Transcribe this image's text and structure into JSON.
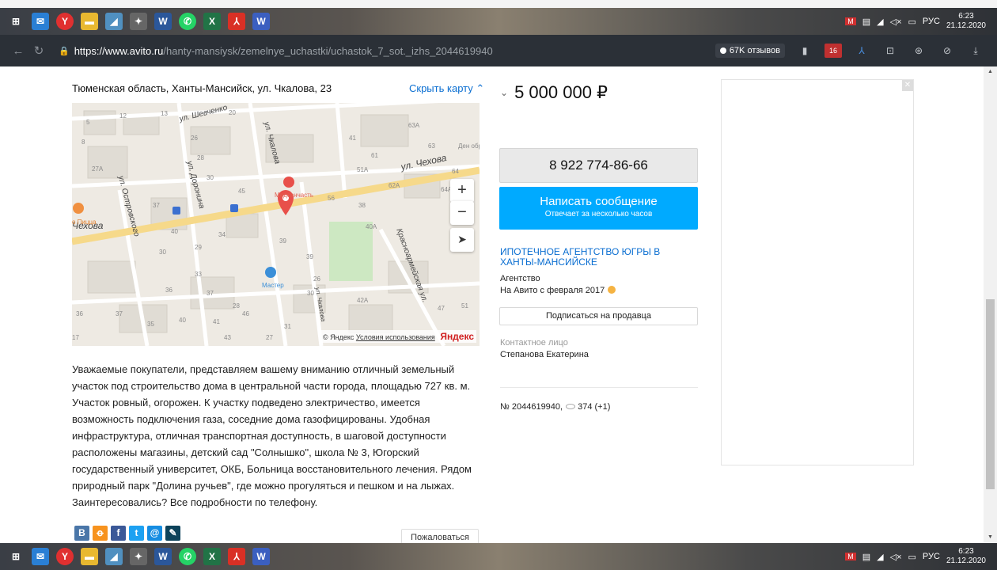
{
  "taskbar": {
    "lang": "РУС",
    "time": "6:23",
    "date": "21.12.2020",
    "icons": [
      "windows-icon",
      "mail-icon",
      "yandex-browser-icon",
      "file-explorer-icon",
      "app-icon",
      "app-icon-2",
      "word-icon",
      "whatsapp-icon",
      "excel-icon",
      "pdf-icon",
      "word-doc-icon"
    ]
  },
  "browser": {
    "url_host": "https://www.avito.ru",
    "url_path": "/hanty-mansiysk/zemelnye_uchastki/uchastok_7_sot._izhs_2044619940",
    "reviews": "67K отзывов",
    "ext_badge": "16"
  },
  "listing": {
    "address": "Тюменская область, Ханты-Мансийск, ул. Чкалова, 23",
    "hide_map": "Скрыть карту",
    "price": "5 000 000 ₽",
    "description": "Уважаемые покупатели, представляем вашему вниманию отличный земельный участок под строительство дома в центральной части города, площадью 727 кв. м. Участок ровный, огорожен. К участку подведено электричество, имеется возможность подключения газа, соседние дома газофицированы. Удобная инфраструктура, отличная транспортная доступность, в шаговой доступности расположены магазины, детский сад \"Солнышко\", школа № 3, Югорский государственный университет, ОКБ, Больница восстановительного лечения. Рядом природный парк \"Долина ручьев\", где можно прогуляться и пешком и на лыжах. Заинтересовались? Все подробности по телефону.",
    "complain": "Пожаловаться",
    "ad_id": "№ 2044619940,",
    "views": "374 (+1)"
  },
  "map": {
    "streets": [
      "ул. Шевченко",
      "ул. Чкалова",
      "ул. Чехова",
      "ул. Доронина",
      "ул. Островского",
      "Чехова",
      "Красноармейская ул.",
      "ул. Чкалова"
    ],
    "pois": [
      "Медсанчасть",
      "Мастер",
      "о Пицца",
      "Ден обр"
    ],
    "copyright": "© Яндекс",
    "terms": "Условия использования",
    "brand": "Яндекс",
    "house_numbers": [
      "12",
      "13",
      "5",
      "8",
      "27А",
      "20",
      "26",
      "28",
      "30",
      "45",
      "37",
      "40",
      "34",
      "29",
      "33",
      "30",
      "36",
      "37",
      "35",
      "40",
      "41",
      "46",
      "43",
      "27",
      "31",
      "39",
      "38",
      "40А",
      "42А",
      "47",
      "51",
      "51А",
      "61",
      "62А",
      "63А",
      "63",
      "64",
      "64А",
      "56",
      "41",
      "17",
      "36",
      "37",
      "28",
      "39",
      "30",
      "26"
    ]
  },
  "seller": {
    "phone": "8 922 774-86-66",
    "message_btn": "Написать сообщение",
    "message_sub": "Отвечает за несколько часов",
    "name": "ИПОТЕЧНОЕ АГЕНТСТВО ЮГРЫ В ХАНТЫ-МАНСИЙСКЕ",
    "type": "Агентство",
    "since": "На Авито с февраля 2017",
    "subscribe": "Подписаться на продавца",
    "contact_label": "Контактное лицо",
    "contact_name": "Степанова Екатерина"
  },
  "colors": {
    "accent": "#00aaff",
    "link": "#0a6ed1",
    "map_pin": "#e8504a"
  }
}
